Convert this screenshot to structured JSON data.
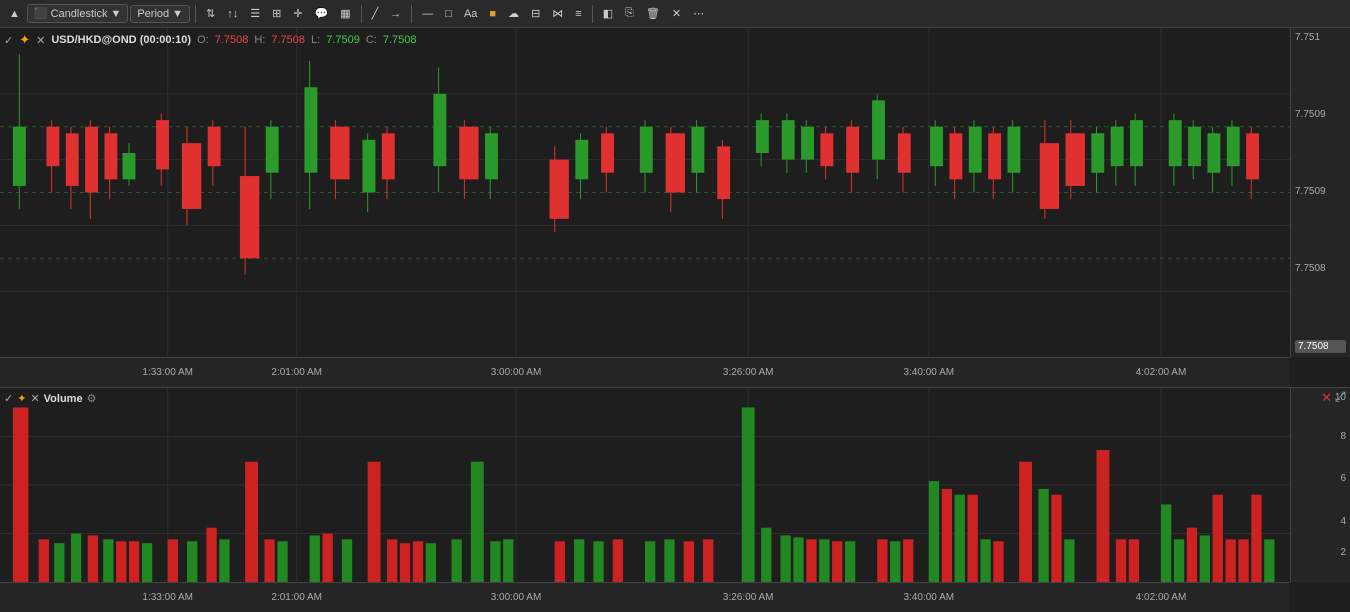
{
  "toolbar": {
    "chart_type": "Candlestick",
    "period": "Period",
    "tools": [
      "arrow-up-icon",
      "arrow-down-icon",
      "list-icon",
      "square-icon",
      "plus-icon",
      "chat-icon",
      "bar-icon",
      "line-icon",
      "arrow-right-icon"
    ],
    "drawing_tools": [
      "line-icon",
      "dash-line-icon",
      "separator",
      "minus-icon",
      "square-outline-icon",
      "text-icon",
      "color-swatch-icon",
      "shape-icon",
      "grid-icon",
      "share-icon",
      "list2-icon"
    ],
    "action_tools": [
      "fill-icon",
      "copy-icon",
      "trash-icon",
      "x-icon",
      "chevron-icon"
    ]
  },
  "price_chart": {
    "symbol": "USD/HKD@OND",
    "period": "(00:00:10)",
    "ohlc": {
      "o_label": "O:",
      "o_value": "7.7508",
      "h_label": "H:",
      "h_value": "7.7508",
      "l_label": "L:",
      "l_value": "7.7509",
      "c_label": "C:",
      "c_value": "7.7508"
    },
    "y_labels": [
      "7.751",
      "7.7509",
      "7.7509",
      "7.7508",
      "7.7508"
    ],
    "y_highlight": "7.7508",
    "x_labels": [
      {
        "time": "1:33:00 AM",
        "pct": 13
      },
      {
        "time": "2:01:00 AM",
        "pct": 23
      },
      {
        "time": "3:00:00 AM",
        "pct": 40
      },
      {
        "time": "3:26:00 AM",
        "pct": 58
      },
      {
        "time": "3:40:00 AM",
        "pct": 72
      },
      {
        "time": "4:02:00 AM",
        "pct": 90
      }
    ]
  },
  "volume_chart": {
    "label": "Volume",
    "y_labels": [
      {
        "value": "10",
        "pct": 0
      },
      {
        "value": "8",
        "pct": 22
      },
      {
        "value": "6",
        "pct": 44
      },
      {
        "value": "4",
        "pct": 66
      },
      {
        "value": "2",
        "pct": 88
      }
    ],
    "x_labels": [
      {
        "time": "1:33:00 AM",
        "pct": 13
      },
      {
        "time": "2:01:00 AM",
        "pct": 23
      },
      {
        "time": "3:00:00 AM",
        "pct": 40
      },
      {
        "time": "3:26:00 AM",
        "pct": 58
      },
      {
        "time": "3:40:00 AM",
        "pct": 72
      },
      {
        "time": "4:02:00 AM",
        "pct": 90
      }
    ]
  },
  "colors": {
    "bg": "#1e1e1e",
    "toolbar_bg": "#2a2a2a",
    "green_candle": "#2a9a2a",
    "red_candle": "#e03030",
    "grid": "#2e2e2e",
    "axis_text": "#aaaaaa",
    "accent_orange": "#ff8800"
  }
}
